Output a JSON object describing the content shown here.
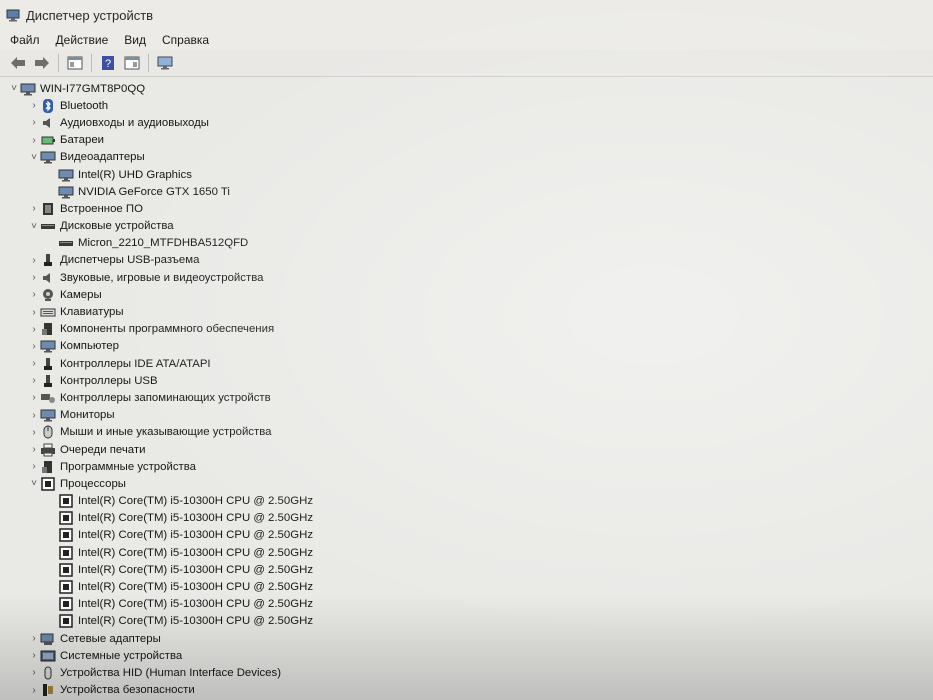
{
  "window": {
    "title": "Диспетчер устройств"
  },
  "menu": {
    "items": [
      "Файл",
      "Действие",
      "Вид",
      "Справка"
    ]
  },
  "tree": {
    "root": "WIN-I77GMT8P0QQ",
    "nodes": [
      {
        "label": "Bluetooth",
        "icon": "bluetooth-icon",
        "expanded": false
      },
      {
        "label": "Аудиовходы и аудиовыходы",
        "icon": "speaker-icon",
        "expanded": false
      },
      {
        "label": "Батареи",
        "icon": "battery-icon",
        "expanded": false
      },
      {
        "label": "Видеоадаптеры",
        "icon": "display-adapter-icon",
        "expanded": true,
        "children": [
          "Intel(R) UHD Graphics",
          "NVIDIA GeForce GTX 1650 Ti"
        ]
      },
      {
        "label": "Встроенное ПО",
        "icon": "firmware-icon",
        "expanded": false
      },
      {
        "label": "Дисковые устройства",
        "icon": "disk-drive-icon",
        "expanded": true,
        "children": [
          "Micron_2210_MTFDHBA512QFD"
        ]
      },
      {
        "label": "Диспетчеры USB-разъема",
        "icon": "usb-connector-icon",
        "expanded": false
      },
      {
        "label": "Звуковые, игровые и видеоустройства",
        "icon": "sound-icon",
        "expanded": false
      },
      {
        "label": "Камеры",
        "icon": "camera-icon",
        "expanded": false
      },
      {
        "label": "Клавиатуры",
        "icon": "keyboard-icon",
        "expanded": false
      },
      {
        "label": "Компоненты программного обеспечения",
        "icon": "software-component-icon",
        "expanded": false
      },
      {
        "label": "Компьютер",
        "icon": "computer-icon",
        "expanded": false
      },
      {
        "label": "Контроллеры IDE ATA/ATAPI",
        "icon": "ide-controller-icon",
        "expanded": false
      },
      {
        "label": "Контроллеры USB",
        "icon": "usb-icon",
        "expanded": false
      },
      {
        "label": "Контроллеры запоминающих устройств",
        "icon": "storage-controller-icon",
        "expanded": false
      },
      {
        "label": "Мониторы",
        "icon": "monitor-icon",
        "expanded": false
      },
      {
        "label": "Мыши и иные указывающие устройства",
        "icon": "mouse-icon",
        "expanded": false
      },
      {
        "label": "Очереди печати",
        "icon": "printer-icon",
        "expanded": false
      },
      {
        "label": "Программные устройства",
        "icon": "software-device-icon",
        "expanded": false
      },
      {
        "label": "Процессоры",
        "icon": "processor-icon",
        "expanded": true,
        "children": [
          "Intel(R) Core(TM) i5-10300H CPU @ 2.50GHz",
          "Intel(R) Core(TM) i5-10300H CPU @ 2.50GHz",
          "Intel(R) Core(TM) i5-10300H CPU @ 2.50GHz",
          "Intel(R) Core(TM) i5-10300H CPU @ 2.50GHz",
          "Intel(R) Core(TM) i5-10300H CPU @ 2.50GHz",
          "Intel(R) Core(TM) i5-10300H CPU @ 2.50GHz",
          "Intel(R) Core(TM) i5-10300H CPU @ 2.50GHz",
          "Intel(R) Core(TM) i5-10300H CPU @ 2.50GHz"
        ]
      },
      {
        "label": "Сетевые адаптеры",
        "icon": "network-adapter-icon",
        "expanded": false
      },
      {
        "label": "Системные устройства",
        "icon": "system-device-icon",
        "expanded": false
      },
      {
        "label": "Устройства HID (Human Interface Devices)",
        "icon": "hid-icon",
        "expanded": false
      },
      {
        "label": "Устройства безопасности",
        "icon": "security-device-icon",
        "expanded": false
      }
    ]
  }
}
